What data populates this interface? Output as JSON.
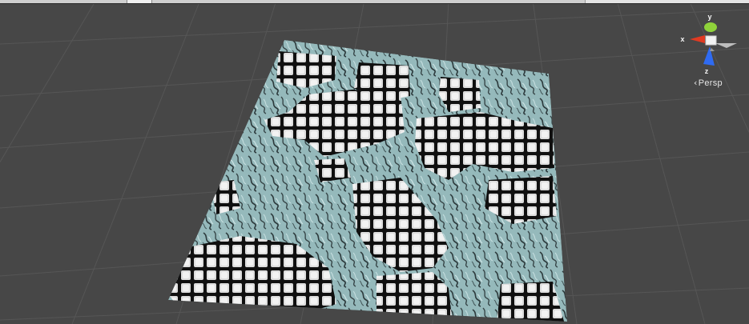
{
  "view": {
    "mode": "scene-view",
    "projection_label": "Persp",
    "background_color": "#474747",
    "grid_color": "#5a5a5a"
  },
  "gizmo": {
    "axes": [
      {
        "label": "y",
        "color": "#8fd23a"
      },
      {
        "label": "x",
        "color": "#e03a22"
      },
      {
        "label": "z",
        "color": "#2f6bf2"
      }
    ],
    "center_color": "#f2f2f2"
  },
  "terrain": {
    "icon": "textured-plane",
    "water_color": "#9fc6c9",
    "tile_light": "#f0f0f0",
    "tile_dark": "#1a1a1a"
  }
}
